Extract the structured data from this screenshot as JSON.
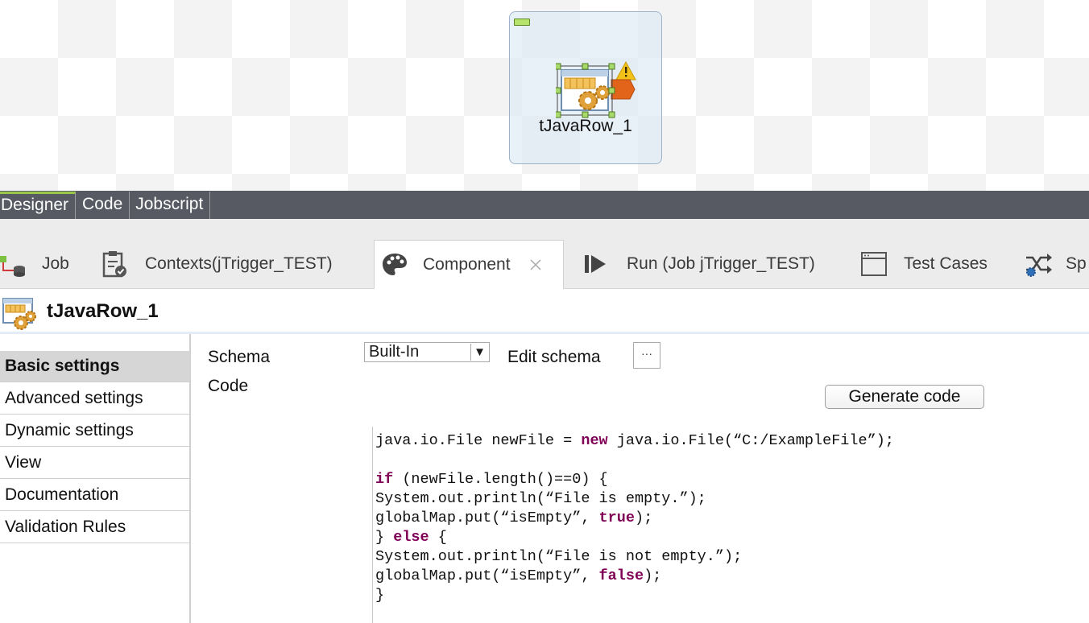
{
  "designer": {
    "node_label": "tJavaRow_1"
  },
  "editor_tabs": [
    "Designer",
    "Code",
    "Jobscript"
  ],
  "view_tabs": {
    "job": "Job",
    "contexts": "Contexts(jTrigger_TEST)",
    "component": "Component",
    "run": "Run (Job jTrigger_TEST)",
    "test_cases": "Test Cases",
    "spark": "Sp"
  },
  "component": {
    "title": "tJavaRow_1"
  },
  "settings_nav": [
    "Basic settings",
    "Advanced settings",
    "Dynamic settings",
    "View",
    "Documentation",
    "Validation Rules"
  ],
  "form": {
    "schema_label": "Schema",
    "schema_value": "Built-In",
    "edit_schema_label": "Edit schema",
    "edit_schema_button": "···",
    "code_label": "Code",
    "generate_button": "Generate code"
  },
  "code": {
    "l1a": "java.io.File newFile = ",
    "l1kw": "new",
    "l1b": " java.io.File(“C:/ExampleFile”);",
    "l2kw": "if",
    "l2b": " (newFile.length()==0) {",
    "l3": "System.out.println(“File is empty.”);",
    "l4a": "globalMap.put(“isEmpty”, ",
    "l4kw": "true",
    "l4b": ");",
    "l5a": "} ",
    "l5kw": "else",
    "l5b": " {",
    "l6": "System.out.println(“File is not empty.”);",
    "l7a": "globalMap.put(“isEmpty”, ",
    "l7kw": "false",
    "l7b": ");",
    "l8": "}"
  },
  "colors": {
    "keyword": "#7f0055",
    "tabbar": "#575a62",
    "accent": "#9ac94a"
  }
}
